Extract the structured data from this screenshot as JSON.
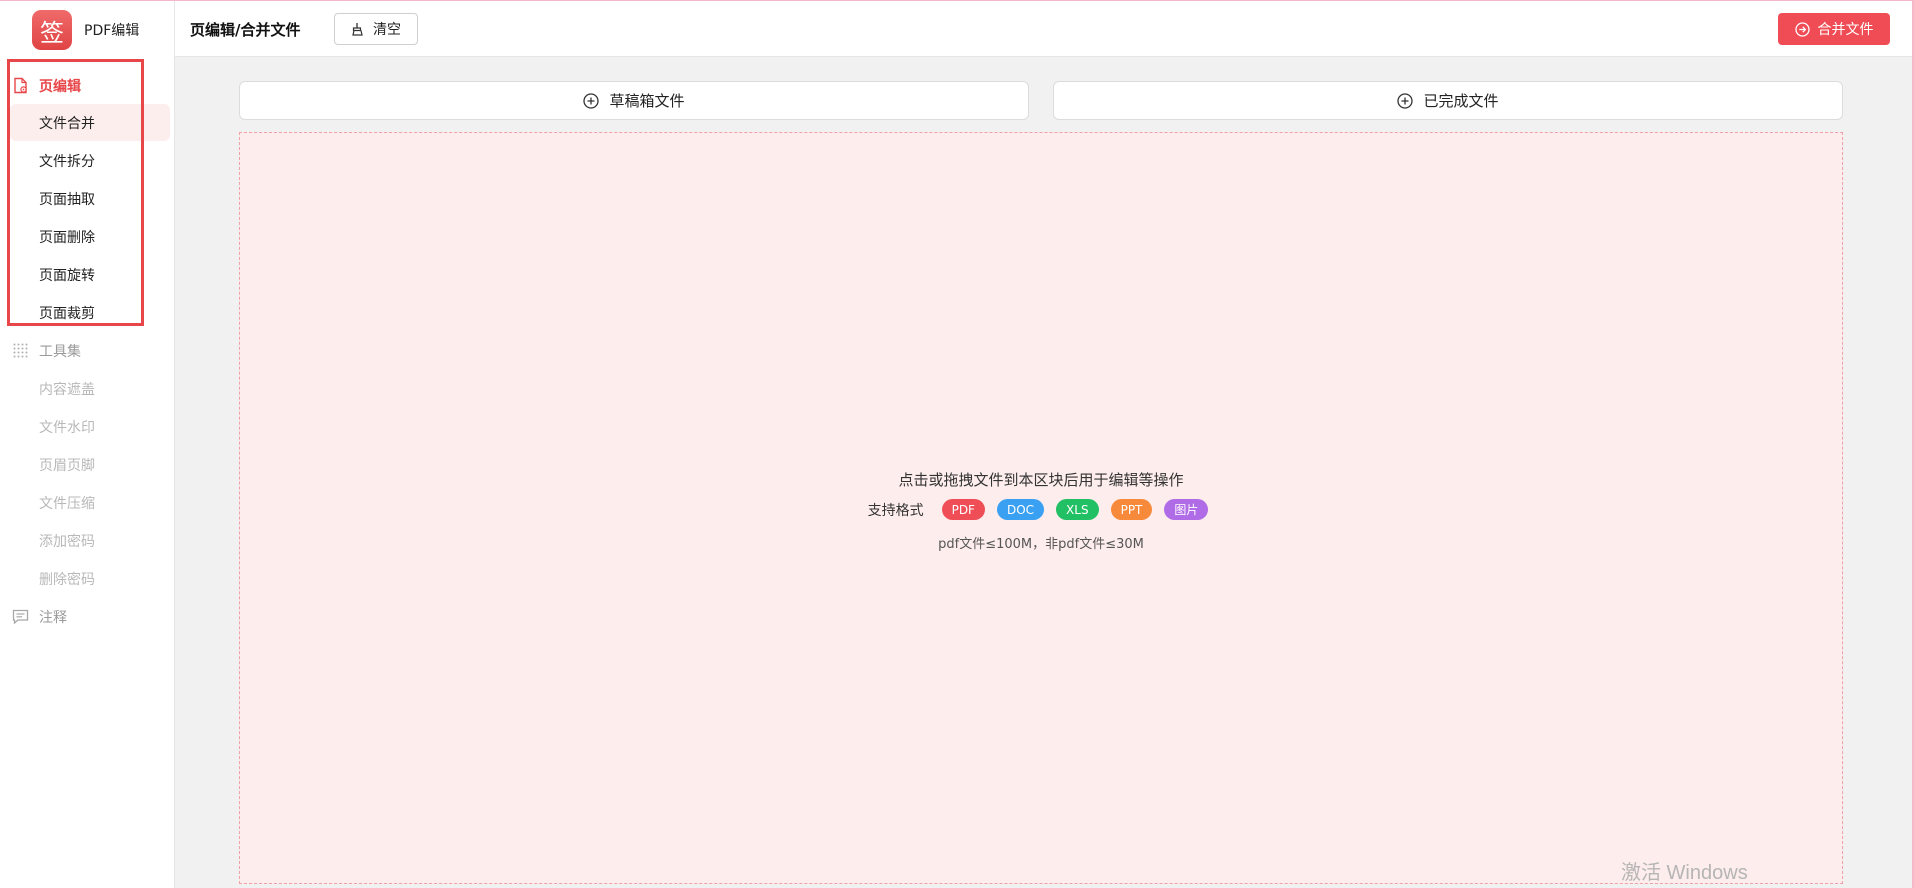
{
  "brand": {
    "logo_char": "签",
    "name": "PDF编辑"
  },
  "sidebar": {
    "groups": [
      {
        "label": "页编辑",
        "icon": "file-edit-icon",
        "items": [
          {
            "label": "文件合并"
          },
          {
            "label": "文件拆分"
          },
          {
            "label": "页面抽取"
          },
          {
            "label": "页面删除"
          },
          {
            "label": "页面旋转"
          },
          {
            "label": "页面裁剪"
          }
        ]
      },
      {
        "label": "工具集",
        "icon": "grid-icon",
        "items": [
          {
            "label": "内容遮盖"
          },
          {
            "label": "文件水印"
          },
          {
            "label": "页眉页脚"
          },
          {
            "label": "文件压缩"
          },
          {
            "label": "添加密码"
          },
          {
            "label": "删除密码"
          }
        ]
      },
      {
        "label": "注释",
        "icon": "comment-icon"
      }
    ],
    "active_item": "文件合并"
  },
  "header": {
    "title": "页编辑/合并文件",
    "clear_label": "清空",
    "merge_label": "合并文件"
  },
  "tabs": {
    "draft": "草稿箱文件",
    "done": "已完成文件"
  },
  "dropzone": {
    "prompt": "点击或拖拽文件到本区块后用于编辑等操作",
    "formats_label": "支持格式",
    "formats": [
      "PDF",
      "DOC",
      "XLS",
      "PPT",
      "图片"
    ],
    "limit": "pdf文件≤100M，非pdf文件≤30M"
  },
  "watermark": "激活 Windows",
  "colors": {
    "accent": "#ef4c55",
    "dropzone_bg": "#feeded"
  }
}
